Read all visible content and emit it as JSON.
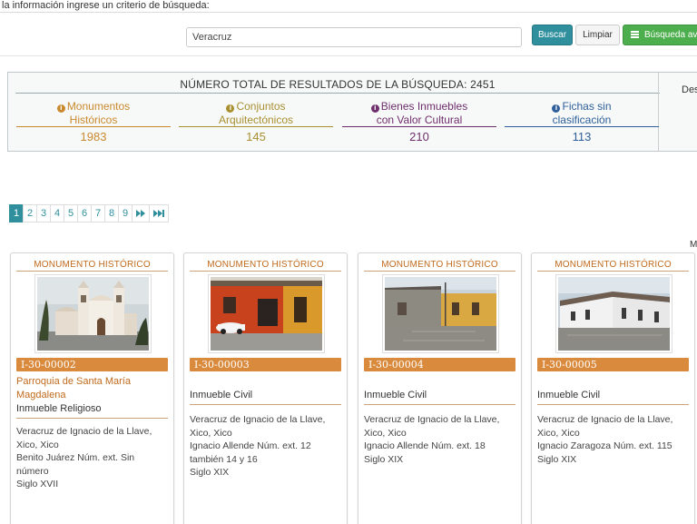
{
  "prompt": "la información ingrese un criterio de búsqueda:",
  "search": {
    "value": "Veracruz",
    "buscar_label": "Buscar",
    "limpiar_label": "Limpiar",
    "avanzada_label": "Búsqueda av"
  },
  "summary": {
    "title": "NÚMERO TOTAL DE RESULTADOS DE LA BÚSQUEDA: 2451",
    "side_label": "Des",
    "categories": [
      {
        "label_line1": "Monumentos",
        "label_line2": "Históricos",
        "count": "1983",
        "color": "#c98a2e"
      },
      {
        "label_line1": "Conjuntos",
        "label_line2": "Arquitectónicos",
        "count": "145",
        "color": "#a89030"
      },
      {
        "label_line1": "Bienes Inmuebles",
        "label_line2": "con Valor Cultural",
        "count": "210",
        "color": "#6f2f6c"
      },
      {
        "label_line1": "Fichas sin",
        "label_line2": "clasificación",
        "count": "113",
        "color": "#2e5f9a"
      }
    ]
  },
  "pagination": {
    "pages": [
      "1",
      "2",
      "3",
      "4",
      "5",
      "6",
      "7",
      "8",
      "9"
    ],
    "active": "1",
    "next_label": "▶▶",
    "last_label": "▶▶|",
    "next_icon": "forward-icon",
    "last_icon": "fast-forward-end-icon"
  },
  "side_letter": "M",
  "cards": [
    {
      "type": "MONUMENTO HISTÓRICO",
      "id": "I-30-00002",
      "name": "Parroquia de Santa María Magdalena",
      "kind": "Inmueble Religioso",
      "details": [
        "Veracruz de Ignacio de la Llave, Xico, Xico",
        "Benito Juárez Núm. ext. Sin número",
        "Siglo XVII"
      ]
    },
    {
      "type": "MONUMENTO HISTÓRICO",
      "id": "I-30-00003",
      "name": "",
      "kind": "Inmueble Civil",
      "details": [
        "Veracruz de Ignacio de la Llave, Xico, Xico",
        "Ignacio Allende Núm. ext. 12 también 14 y 16",
        "Siglo XIX"
      ]
    },
    {
      "type": "MONUMENTO HISTÓRICO",
      "id": "I-30-00004",
      "name": "",
      "kind": "Inmueble Civil",
      "details": [
        "Veracruz de Ignacio de la Llave, Xico, Xico",
        "Ignacio Allende Núm. ext. 18",
        "Siglo XIX"
      ]
    },
    {
      "type": "MONUMENTO HISTÓRICO",
      "id": "I-30-00005",
      "name": "",
      "kind": "Inmueble Civil",
      "details": [
        "Veracruz de Ignacio de la Llave, Xico, Xico",
        "Ignacio Zaragoza Núm. ext. 115",
        "Siglo XIX"
      ]
    }
  ]
}
